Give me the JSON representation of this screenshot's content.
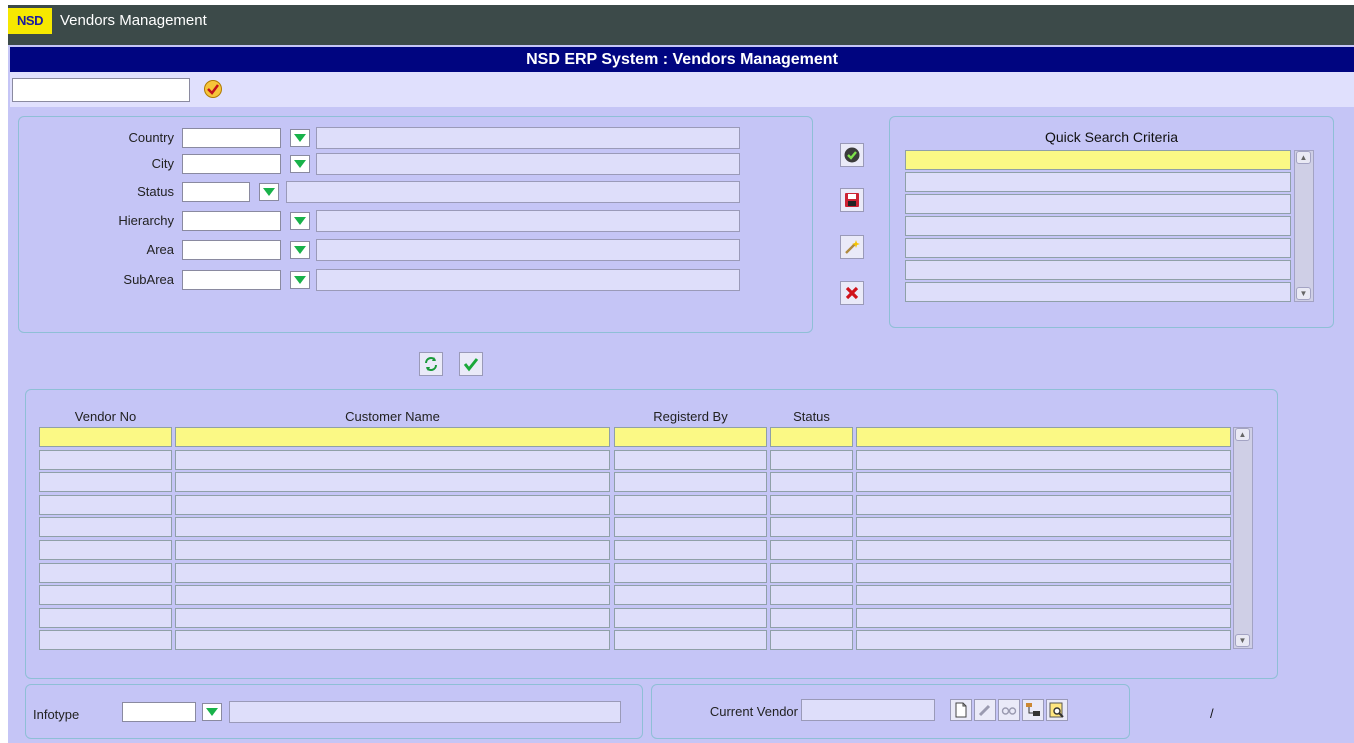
{
  "window": {
    "logo_text": "NSD",
    "title": "Vendors Management"
  },
  "banner": {
    "title": "NSD ERP System : Vendors Management"
  },
  "top": {
    "input_value": ""
  },
  "filters": [
    {
      "label": "Country",
      "code": "",
      "desc": ""
    },
    {
      "label": "City",
      "code": "",
      "desc": ""
    },
    {
      "label": "Status",
      "code": "",
      "desc": ""
    },
    {
      "label": "Hierarchy",
      "code": "",
      "desc": ""
    },
    {
      "label": "Area",
      "code": "",
      "desc": ""
    },
    {
      "label": "SubArea",
      "code": "",
      "desc": ""
    }
  ],
  "actions": {
    "icons": [
      "check-icon",
      "save-icon",
      "wand-icon",
      "delete-icon"
    ]
  },
  "quick_search": {
    "title": "Quick Search Criteria",
    "rows": [
      "",
      "",
      "",
      "",
      "",
      "",
      ""
    ]
  },
  "grid": {
    "columns": [
      "Vendor No",
      "Customer Name",
      "Registerd By",
      "Status",
      ""
    ],
    "rows": [
      [
        "",
        "",
        "",
        "",
        ""
      ],
      [
        "",
        "",
        "",
        "",
        ""
      ],
      [
        "",
        "",
        "",
        "",
        ""
      ],
      [
        "",
        "",
        "",
        "",
        ""
      ],
      [
        "",
        "",
        "",
        "",
        ""
      ],
      [
        "",
        "",
        "",
        "",
        ""
      ],
      [
        "",
        "",
        "",
        "",
        ""
      ],
      [
        "",
        "",
        "",
        "",
        ""
      ],
      [
        "",
        "",
        "",
        "",
        ""
      ],
      [
        "",
        "",
        "",
        "",
        ""
      ]
    ]
  },
  "infotype": {
    "label": "Infotype",
    "code": "",
    "desc": ""
  },
  "current_vendor": {
    "label": "Current Vendor",
    "value": ""
  },
  "footer_mark": "/",
  "colors": {
    "banner": "#000580",
    "panel_bg": "#c5c5f6",
    "selected_row": "#fbf985",
    "lov_arrow": "#19b24a"
  }
}
